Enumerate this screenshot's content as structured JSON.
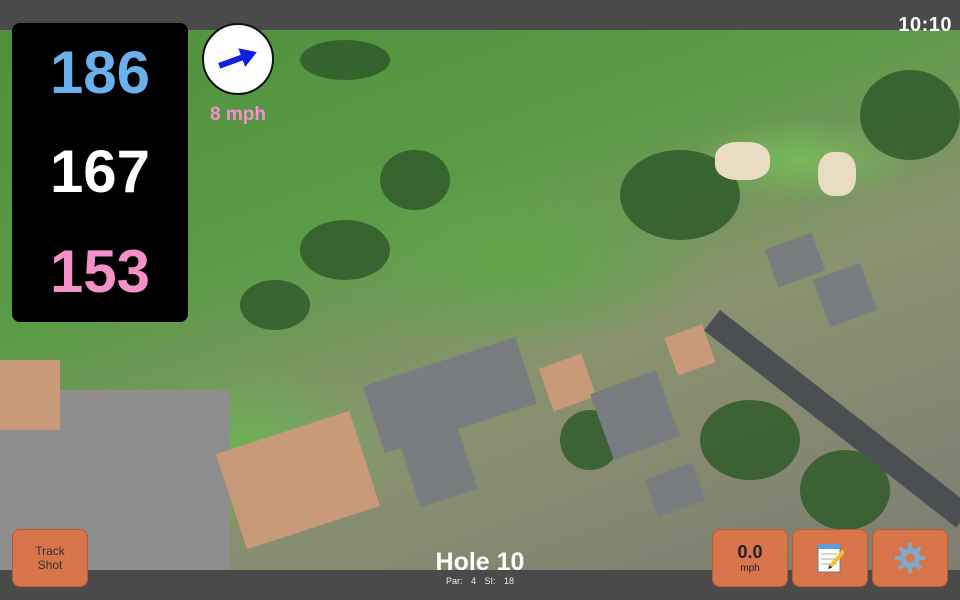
{
  "status": {
    "time": "10:10"
  },
  "distances": {
    "back": "186",
    "middle": "167",
    "front": "153"
  },
  "wind": {
    "speed": "8 mph",
    "icon": "arrow-icon"
  },
  "hole": {
    "title": "Hole 10",
    "par": "Par: 4",
    "si": "SI: 18"
  },
  "buttons": {
    "track_shot": "Track\nShot",
    "speed_value": "0.0",
    "speed_unit": "mph",
    "notes_icon": "notepad-icon",
    "settings_icon": "gear-icon"
  },
  "colors": {
    "back": "#6bb0ec",
    "middle": "#ffffff",
    "front": "#f590c8",
    "button": "#d9754a",
    "wind_text": "#f78fd1"
  }
}
